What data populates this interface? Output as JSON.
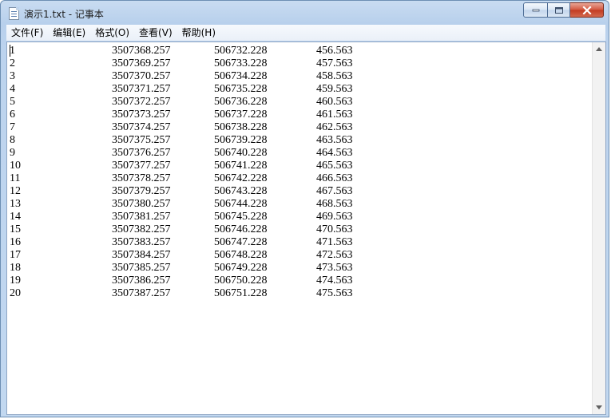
{
  "window": {
    "title": "演示1.txt - 记事本",
    "buttons": {
      "minimize_icon": "minimize-icon",
      "maximize_icon": "maximize-icon",
      "close_icon": "close-icon"
    }
  },
  "menu": [
    {
      "label": "文件(F)"
    },
    {
      "label": "编辑(E)"
    },
    {
      "label": "格式(O)"
    },
    {
      "label": "查看(V)"
    },
    {
      "label": "帮助(H)"
    }
  ],
  "document": {
    "rows": [
      [
        "1",
        "3507368.257",
        "506732.228",
        "456.563"
      ],
      [
        "2",
        "3507369.257",
        "506733.228",
        "457.563"
      ],
      [
        "3",
        "3507370.257",
        "506734.228",
        "458.563"
      ],
      [
        "4",
        "3507371.257",
        "506735.228",
        "459.563"
      ],
      [
        "5",
        "3507372.257",
        "506736.228",
        "460.563"
      ],
      [
        "6",
        "3507373.257",
        "506737.228",
        "461.563"
      ],
      [
        "7",
        "3507374.257",
        "506738.228",
        "462.563"
      ],
      [
        "8",
        "3507375.257",
        "506739.228",
        "463.563"
      ],
      [
        "9",
        "3507376.257",
        "506740.228",
        "464.563"
      ],
      [
        "10",
        "3507377.257",
        "506741.228",
        "465.563"
      ],
      [
        "11",
        "3507378.257",
        "506742.228",
        "466.563"
      ],
      [
        "12",
        "3507379.257",
        "506743.228",
        "467.563"
      ],
      [
        "13",
        "3507380.257",
        "506744.228",
        "468.563"
      ],
      [
        "14",
        "3507381.257",
        "506745.228",
        "469.563"
      ],
      [
        "15",
        "3507382.257",
        "506746.228",
        "470.563"
      ],
      [
        "16",
        "3507383.257",
        "506747.228",
        "471.563"
      ],
      [
        "17",
        "3507384.257",
        "506748.228",
        "472.563"
      ],
      [
        "18",
        "3507385.257",
        "506749.228",
        "473.563"
      ],
      [
        "19",
        "3507386.257",
        "506750.228",
        "474.563"
      ],
      [
        "20",
        "3507387.257",
        "506751.228",
        "475.563"
      ]
    ]
  },
  "colors": {
    "titlebar": "#bcd3ee",
    "close_button": "#c23a20",
    "text": "#000000"
  }
}
